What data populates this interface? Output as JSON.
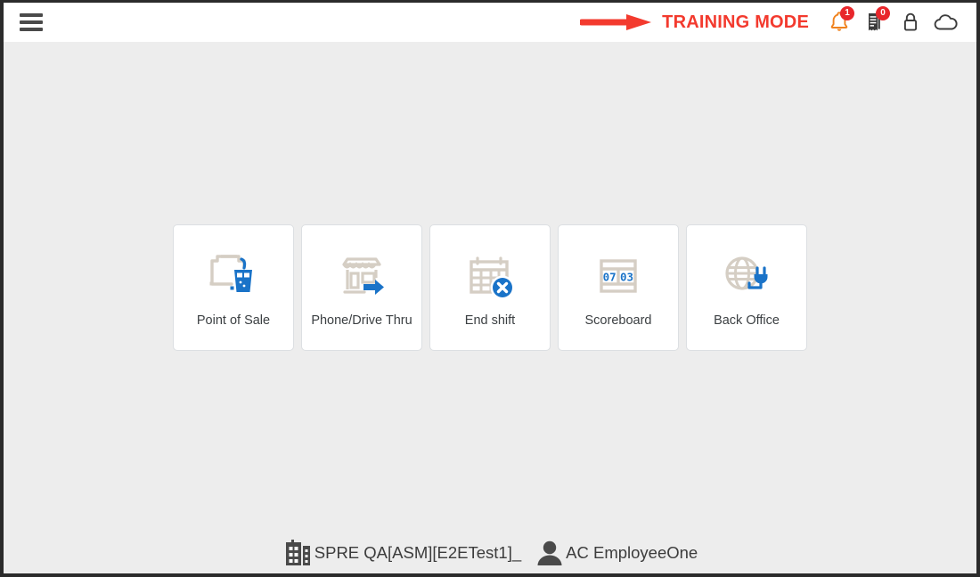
{
  "header": {
    "menu_icon": "hamburger-menu-icon",
    "arrow_annotation": "red-arrow-annotation",
    "training_label": "TRAINING MODE",
    "training_color": "#f33a2e",
    "icons": [
      {
        "name": "notifications-bell-icon",
        "badge": "1",
        "badge_color": "#e8262b",
        "color": "#f0821e"
      },
      {
        "name": "open-checks-receipt-icon",
        "badge": "0",
        "badge_color": "#e8262b",
        "color": "#3c3c3c"
      },
      {
        "name": "lock-icon",
        "badge": null,
        "color": "#3c3c3c"
      },
      {
        "name": "cloud-icon",
        "badge": null,
        "color": "#3c3c3c"
      }
    ]
  },
  "main": {
    "tiles": [
      {
        "label": "Point of Sale",
        "icon": "receipt-and-drink-cup-icon"
      },
      {
        "label": "Phone/Drive Thru",
        "icon": "storefront-with-arrow-icon"
      },
      {
        "label": "End shift",
        "icon": "calendar-with-x-icon"
      },
      {
        "label": "Scoreboard",
        "icon": "scoreboard-icon",
        "left_digits": "07",
        "right_digits": "03"
      },
      {
        "label": "Back Office",
        "icon": "globe-with-plug-icon"
      }
    ],
    "accent_blue": "#1a73c8",
    "accent_beige": "#d5cec4"
  },
  "footer": {
    "store_icon": "building-icon",
    "store_name": "SPRE QA[ASM][E2ETest1]_",
    "user_icon": "person-avatar-icon",
    "user_name": "AC EmployeeOne"
  }
}
